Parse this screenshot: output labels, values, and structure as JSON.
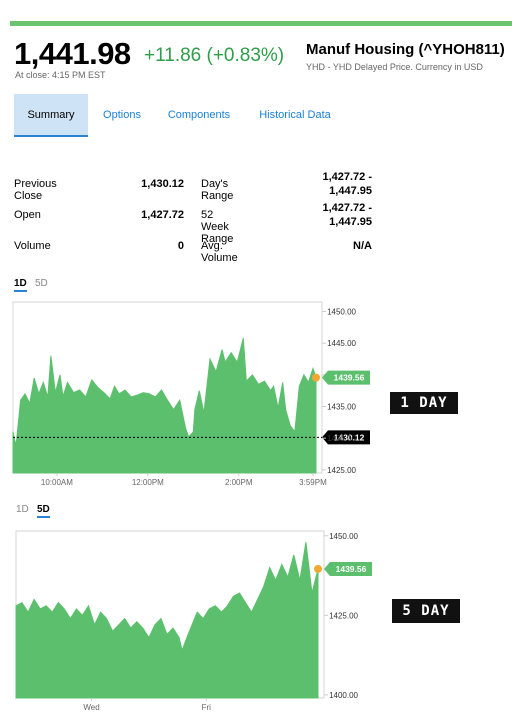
{
  "quote": {
    "price": "1,441.98",
    "change": "+11.86 (+0.83%)",
    "close_note": "At close: 4:15 PM EST",
    "name": "Manuf Housing (^YHOH811)",
    "subtitle": "YHD - YHD Delayed Price. Currency in USD",
    "accent_color": "#2e9e49"
  },
  "tabs": [
    {
      "label": "Summary",
      "active": true
    },
    {
      "label": "Options",
      "active": false
    },
    {
      "label": "Components",
      "active": false
    },
    {
      "label": "Historical Data",
      "active": false
    }
  ],
  "stats": {
    "previous_close": {
      "label": "Previous Close",
      "value": "1,430.12"
    },
    "open": {
      "label": "Open",
      "value": "1,427.72"
    },
    "volume": {
      "label": "Volume",
      "value": "0"
    },
    "days_range": {
      "label": "Day's Range",
      "value_line1": "1,427.72 -",
      "value_line2": "1,447.95"
    },
    "week52_range": {
      "label": "52 Week Range",
      "value_line1": "1,427.72 -",
      "value_line2": "1,447.95"
    },
    "avg_volume": {
      "label": "Avg. Volume",
      "value": "N/A"
    }
  },
  "toggle1": {
    "d1": "1D",
    "d5": "5D",
    "active": "1D"
  },
  "toggle2": {
    "d1": "1D",
    "d5": "5D",
    "active": "5D"
  },
  "badges": {
    "one_day": "1 DAY",
    "five_day": "5 DAY"
  },
  "chart_data": [
    {
      "type": "area",
      "color": "#5cbf6d",
      "ylim": [
        1424.5,
        1451.5
      ],
      "yticks": [
        "1450.00",
        "1445.00",
        "1440.00",
        "1435.00",
        "1430.00",
        "1425.00"
      ],
      "ytick_values": [
        1450,
        1445,
        1440,
        1435,
        1430,
        1425
      ],
      "xtick_labels": [
        "10:00AM",
        "12:00PM",
        "2:00PM",
        "3:59PM"
      ],
      "xtick_positions": [
        0.145,
        0.445,
        0.745,
        0.99
      ],
      "last_value": 1439.56,
      "last_label": "1439.56",
      "prev_close": 1430.12,
      "prev_close_label": "1430.12",
      "x": [
        0,
        0.01,
        0.025,
        0.04,
        0.055,
        0.07,
        0.085,
        0.1,
        0.115,
        0.125,
        0.14,
        0.155,
        0.165,
        0.18,
        0.2,
        0.22,
        0.24,
        0.26,
        0.28,
        0.3,
        0.32,
        0.335,
        0.35,
        0.37,
        0.39,
        0.41,
        0.43,
        0.45,
        0.47,
        0.49,
        0.51,
        0.53,
        0.55,
        0.57,
        0.58,
        0.595,
        0.6,
        0.615,
        0.63,
        0.65,
        0.67,
        0.69,
        0.7,
        0.72,
        0.74,
        0.76,
        0.77,
        0.79,
        0.81,
        0.83,
        0.85,
        0.86,
        0.875,
        0.89,
        0.9,
        0.915,
        0.93,
        0.945,
        0.96,
        0.975,
        0.99,
        1.0
      ],
      "y": [
        1431.0,
        1428.8,
        1436.0,
        1437.0,
        1435.5,
        1439.5,
        1437.0,
        1438.8,
        1436.5,
        1443.0,
        1437.2,
        1440.0,
        1436.6,
        1438.8,
        1437.2,
        1437.6,
        1436.5,
        1439.2,
        1438.0,
        1437.2,
        1436.2,
        1438.2,
        1437.0,
        1437.6,
        1436.5,
        1436.8,
        1437.2,
        1437.0,
        1436.5,
        1437.6,
        1436.0,
        1434.5,
        1436.0,
        1431.5,
        1430.2,
        1431.0,
        1434.5,
        1437.5,
        1434.0,
        1442.5,
        1440.5,
        1444.0,
        1442.0,
        1443.5,
        1442.0,
        1445.8,
        1439.0,
        1440.0,
        1438.5,
        1439.0,
        1437.5,
        1438.2,
        1434.8,
        1438.8,
        1434.5,
        1432.0,
        1431.0,
        1438.2,
        1440.0,
        1438.8,
        1441.0,
        1439.56
      ]
    },
    {
      "type": "area",
      "color": "#5cbf6d",
      "ylim": [
        1399,
        1451.5
      ],
      "yticks": [
        "1450.00",
        "1425.00",
        "1400.00"
      ],
      "ytick_values": [
        1450,
        1425,
        1400
      ],
      "xtick_labels": [
        "Wed",
        "Fri"
      ],
      "xtick_positions": [
        0.25,
        0.63
      ],
      "last_value": 1439.56,
      "last_label": "1439.56",
      "x": [
        0,
        0.02,
        0.04,
        0.06,
        0.08,
        0.1,
        0.12,
        0.14,
        0.16,
        0.18,
        0.2,
        0.22,
        0.24,
        0.26,
        0.28,
        0.3,
        0.32,
        0.34,
        0.36,
        0.38,
        0.4,
        0.42,
        0.44,
        0.46,
        0.48,
        0.5,
        0.52,
        0.54,
        0.55,
        0.57,
        0.6,
        0.62,
        0.64,
        0.66,
        0.68,
        0.7,
        0.72,
        0.74,
        0.76,
        0.78,
        0.8,
        0.82,
        0.84,
        0.86,
        0.88,
        0.9,
        0.92,
        0.94,
        0.96,
        0.98,
        1.0
      ],
      "y": [
        1428,
        1429,
        1426,
        1430,
        1427,
        1428,
        1426,
        1429,
        1427,
        1424,
        1427,
        1425,
        1428,
        1422,
        1426,
        1424,
        1420,
        1422,
        1424,
        1421,
        1423,
        1421,
        1418,
        1422,
        1424,
        1419,
        1421,
        1418,
        1414,
        1419,
        1426,
        1424,
        1427,
        1428,
        1426,
        1428,
        1431,
        1432,
        1429,
        1426,
        1430,
        1434,
        1440,
        1436,
        1441,
        1437,
        1444,
        1436,
        1448,
        1432,
        1439.56
      ]
    }
  ]
}
